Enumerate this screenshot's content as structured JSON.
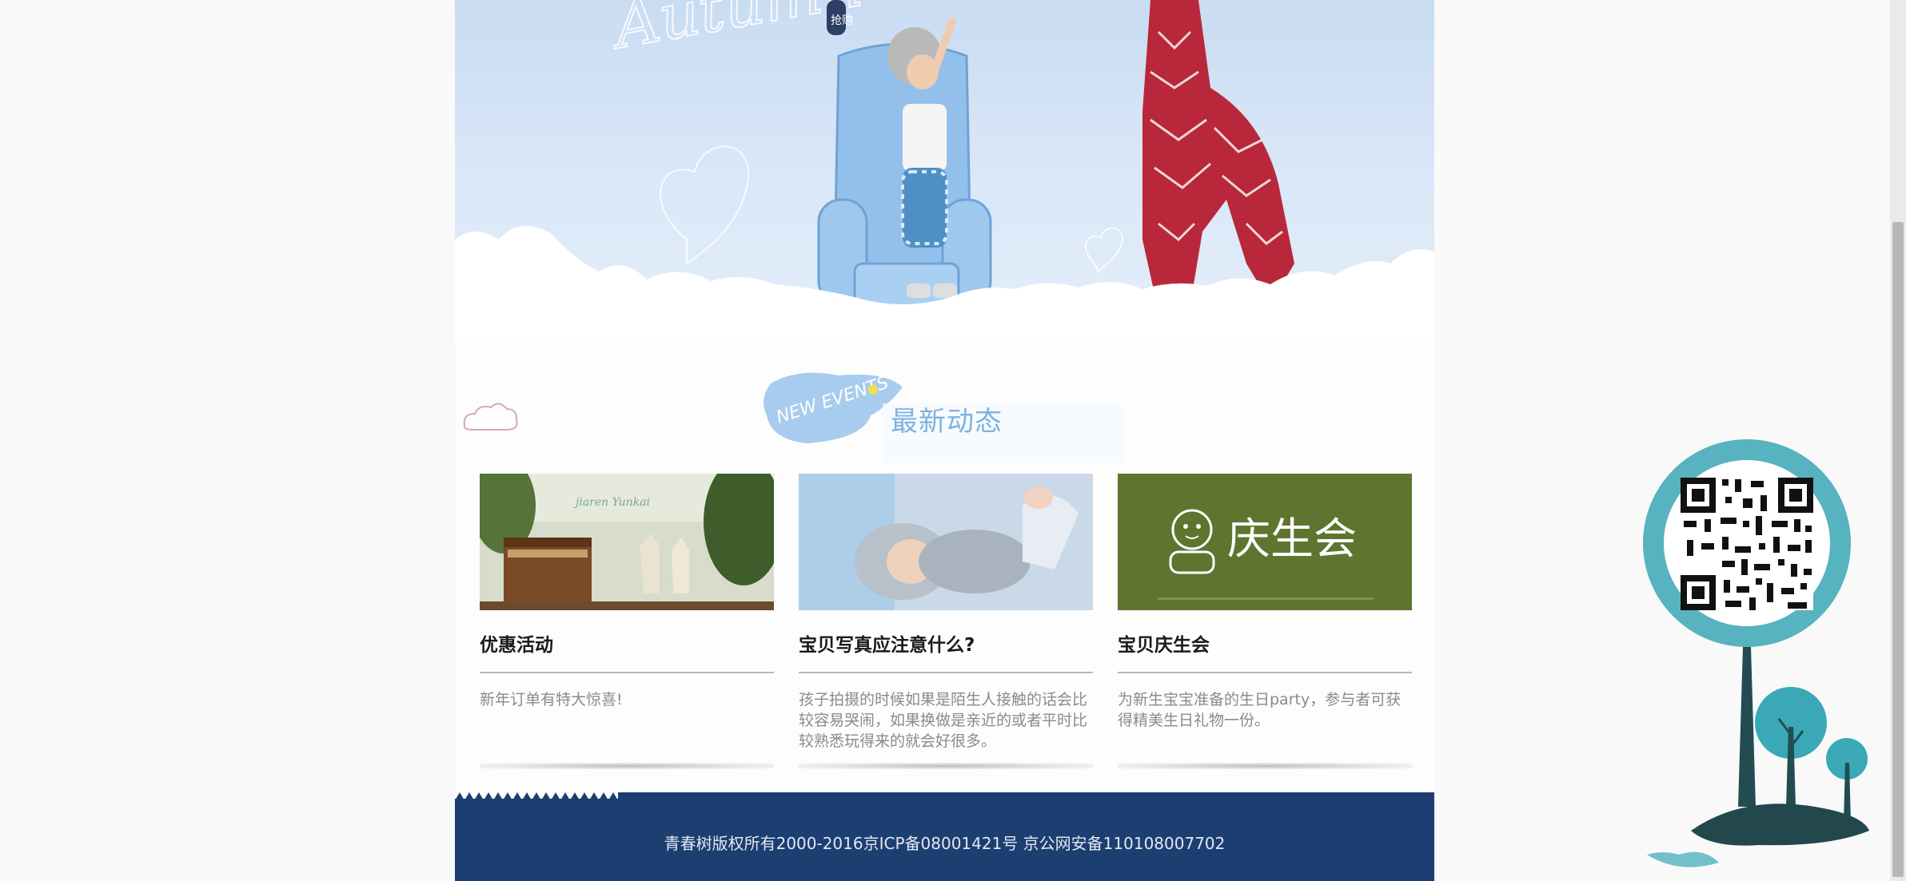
{
  "hero": {
    "script_text": "Autumn",
    "tag_text": "抢购"
  },
  "section": {
    "badge_text": "NEW EVENTS",
    "title": "最新动态"
  },
  "cards": [
    {
      "title": "优惠活动",
      "desc": "新年订单有特大惊喜!",
      "thumb_caption": "jiaren Yunkai"
    },
    {
      "title": "宝贝写真应注意什么?",
      "desc": "孩子拍摄的时候如果是陌生人接触的话会比较容易哭闹，如果换做是亲近的或者平时比较熟悉玩得来的就会好很多。"
    },
    {
      "title": "宝贝庆生会",
      "desc": "为新生宝宝准备的生日party，参与者可获得精美生日礼物一份。",
      "thumb_caption": "庆生会"
    }
  ],
  "footer": {
    "text": "青春树版权所有2000-2016京ICP备08001421号 京公网安备110108007702"
  },
  "colors": {
    "footer_bg": "#1d3e70",
    "title_blue": "#7fb2df",
    "card3_bg": "#5e7530",
    "qr_teal": "#3aa8b6"
  }
}
